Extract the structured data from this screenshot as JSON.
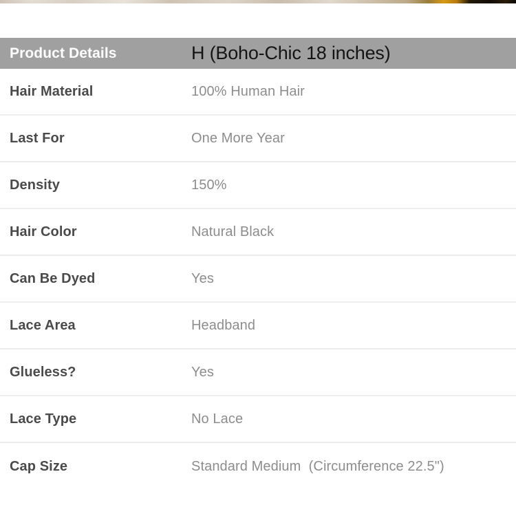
{
  "page": {
    "background_color": "#ffffff",
    "top_image_strip": {
      "description": "cropped photo sliver",
      "visible": true
    }
  },
  "spec_table": {
    "header": {
      "label": "Product Details",
      "value": "H (Boho-Chic 18 inches)",
      "background_color": "#a0a0a0",
      "label_color": "#ffffff",
      "value_color": "#141414"
    },
    "divider_color": "#ededed",
    "label_color": "#4a4a4a",
    "value_color": "#8d8d8d",
    "rows": [
      {
        "label": "Hair Material",
        "value": "100% Human Hair"
      },
      {
        "label": "Last For",
        "value": "One More Year"
      },
      {
        "label": "Density",
        "value": "150%"
      },
      {
        "label": "Hair Color",
        "value": "Natural Black"
      },
      {
        "label": "Can Be Dyed",
        "value": "Yes"
      },
      {
        "label": "Lace Area",
        "value": "Headband"
      },
      {
        "label": "Glueless?",
        "value": "Yes"
      },
      {
        "label": "Lace Type",
        "value": "No Lace"
      },
      {
        "label": "Cap Size",
        "value": "Standard Medium  (Circumference 22.5\")"
      }
    ]
  }
}
